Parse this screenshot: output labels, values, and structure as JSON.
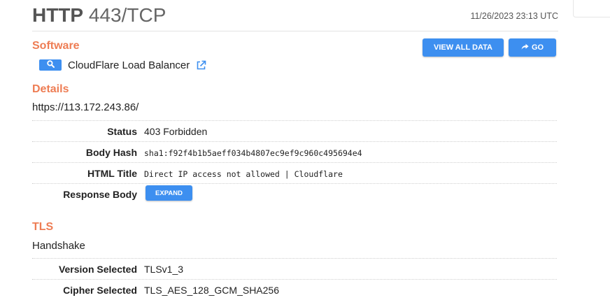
{
  "header": {
    "protocol": "HTTP",
    "port": "443/TCP",
    "timestamp": "11/26/2023 23:13 UTC"
  },
  "actions": {
    "view_all_label": "VIEW ALL DATA",
    "go_label": "GO"
  },
  "software": {
    "title": "Software",
    "name": "CloudFlare Load Balancer"
  },
  "details": {
    "title": "Details",
    "url": "https://113.172.243.86/",
    "rows": [
      {
        "key": "Status",
        "value": "403  Forbidden"
      },
      {
        "key": "Body Hash",
        "value": "sha1:f92f4b1b5aeff034b4807ec9ef9c960c495694e4"
      },
      {
        "key": "HTML Title",
        "value": "Direct IP access not allowed | Cloudflare"
      },
      {
        "key": "Response Body",
        "expand_label": "EXPAND"
      }
    ]
  },
  "tls": {
    "title": "TLS",
    "subtitle": "Handshake",
    "rows": [
      {
        "key": "Version Selected",
        "value": "TLSv1_3"
      },
      {
        "key": "Cipher Selected",
        "value": "TLS_AES_128_GCM_SHA256"
      }
    ]
  },
  "colors": {
    "accent": "#ee7d54",
    "button": "#3d8ff0",
    "text": "#222222",
    "muted": "#555555"
  },
  "icons": {
    "search": "search-icon",
    "external_link": "external-link-icon",
    "go": "share-arrow-icon"
  }
}
